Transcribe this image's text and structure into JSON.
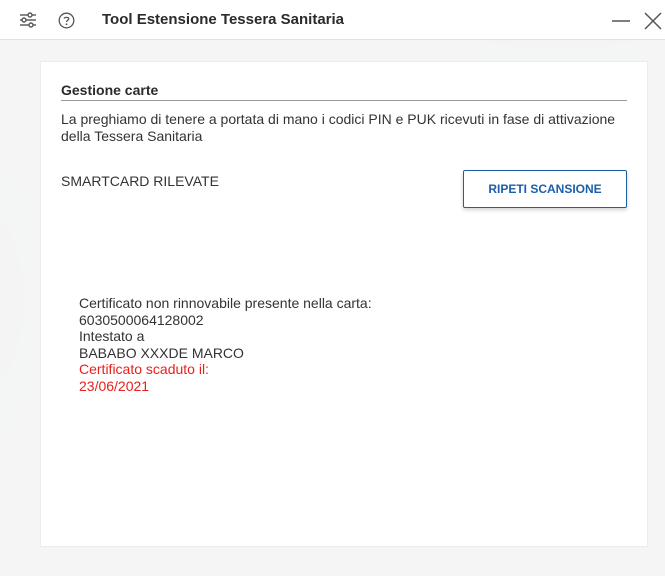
{
  "titlebar": {
    "title": "Tool Estensione Tessera Sanitaria",
    "settings_icon": "sliders-icon",
    "help_icon": "question-circle-icon",
    "minimize_icon": "minimize-icon",
    "close_icon": "close-icon"
  },
  "panel": {
    "section_title": "Gestione carte",
    "instructions": "La preghiamo di tenere a portata di mano i codici PIN e PUK ricevuti in fase di attivazione della Tessera Sanitaria",
    "detected_label": "SMARTCARD RILEVATE",
    "rescan_button": "RIPETI SCANSIONE"
  },
  "certificate": {
    "heading": "Certificato non rinnovabile presente nella carta:",
    "number": "6030500064128002",
    "holder_label": "Intestato a",
    "holder_name": "BABABO XXXDE MARCO",
    "expired_label": "Certificato scaduto il:",
    "expired_date": "23/06/2021"
  },
  "colors": {
    "accent": "#1b5fa8",
    "expired": "#e8211b"
  }
}
